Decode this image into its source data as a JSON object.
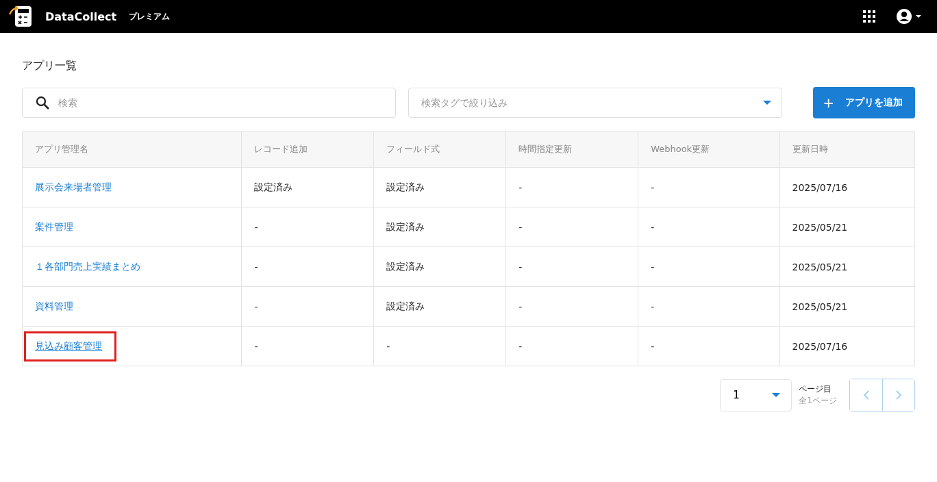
{
  "header": {
    "brand": "DataCollect",
    "plan": "プレミアム"
  },
  "page_title": "アプリ一覧",
  "search": {
    "placeholder": "検索"
  },
  "tag_filter": {
    "placeholder": "検索タグで絞り込み"
  },
  "add_button": {
    "icon": "+",
    "label": "アプリを追加"
  },
  "table": {
    "columns": [
      "アプリ管理名",
      "レコード追加",
      "フィールド式",
      "時間指定更新",
      "Webhook更新",
      "更新日時"
    ],
    "rows": [
      {
        "cells": [
          "展示会来場者管理",
          "設定済み",
          "設定済み",
          "-",
          "-",
          "2025/07/16"
        ],
        "highlighted": false
      },
      {
        "cells": [
          "案件管理",
          "-",
          "設定済み",
          "-",
          "-",
          "2025/05/21"
        ],
        "highlighted": false
      },
      {
        "cells": [
          "１各部門売上実績まとめ",
          "-",
          "設定済み",
          "-",
          "-",
          "2025/05/21"
        ],
        "highlighted": false
      },
      {
        "cells": [
          "資料管理",
          "-",
          "設定済み",
          "-",
          "-",
          "2025/05/21"
        ],
        "highlighted": false
      },
      {
        "cells": [
          "見込み顧客管理",
          "-",
          "-",
          "-",
          "-",
          "2025/07/16"
        ],
        "highlighted": true
      }
    ]
  },
  "pagination": {
    "page": "1",
    "page_label": "ページ目",
    "total": "全1ページ",
    "prev_disabled": true,
    "next_disabled": true
  }
}
